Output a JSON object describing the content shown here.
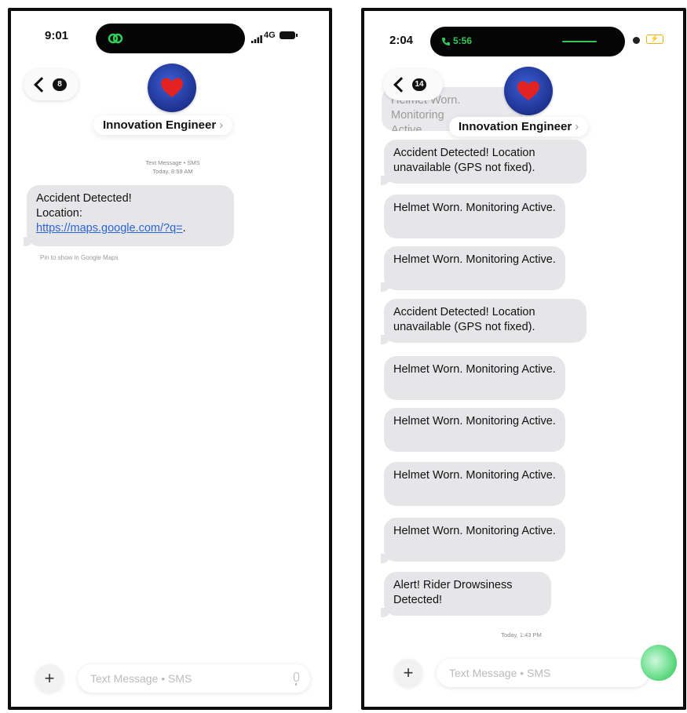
{
  "left": {
    "status": {
      "time": "9:01",
      "signal": "4G"
    },
    "back_count": "8",
    "contact_name": "Innovation Engineer",
    "contact_chevron": "›",
    "meta_line1": "Text Message • SMS",
    "meta_line2": "Today, 8:59 AM",
    "message": {
      "line1": "Accident Detected!",
      "line2": "Location:",
      "link": "https://maps.google.com/?q=",
      "link_suffix": "."
    },
    "map_hint": "Pin to show in Google Maps",
    "input_placeholder": "Text Message • SMS"
  },
  "right": {
    "status": {
      "time": "2:04",
      "call_timer": "5:56"
    },
    "back_count": "14",
    "contact_name": "Innovation Engineer",
    "contact_chevron": "›",
    "partial_top_line": "Helmet Worn. Monitoring",
    "partial_top_line2": "Active.",
    "messages": [
      "Accident Detected! Location unavailable (GPS not fixed).",
      "Helmet Worn. Monitoring Active.",
      "Helmet Worn. Monitoring Active.",
      "Accident Detected! Location unavailable (GPS not fixed).",
      "Helmet Worn. Monitoring Active.",
      "Helmet Worn. Monitoring Active.",
      "Helmet Worn. Monitoring Active.",
      "Helmet Worn. Monitoring Active.",
      "Alert! Rider Drowsiness Detected!"
    ],
    "timestamp": "Today, 1:43 PM",
    "input_placeholder": "Text Message • SMS"
  },
  "icons": {
    "back": "chevron-left-icon",
    "avatar": "heart-icon",
    "plus": "plus-icon",
    "mic": "microphone-icon",
    "link_status": "link-icon",
    "phone_status": "phone-icon",
    "battery": "battery-icon",
    "signal": "signal-bars-icon"
  },
  "colors": {
    "bubble": "#e6e6e9",
    "link": "#2a64d8",
    "avatar": "#2a47b8",
    "heart": "#e32222",
    "island_link": "#30d158",
    "call_green": "#34c759"
  }
}
